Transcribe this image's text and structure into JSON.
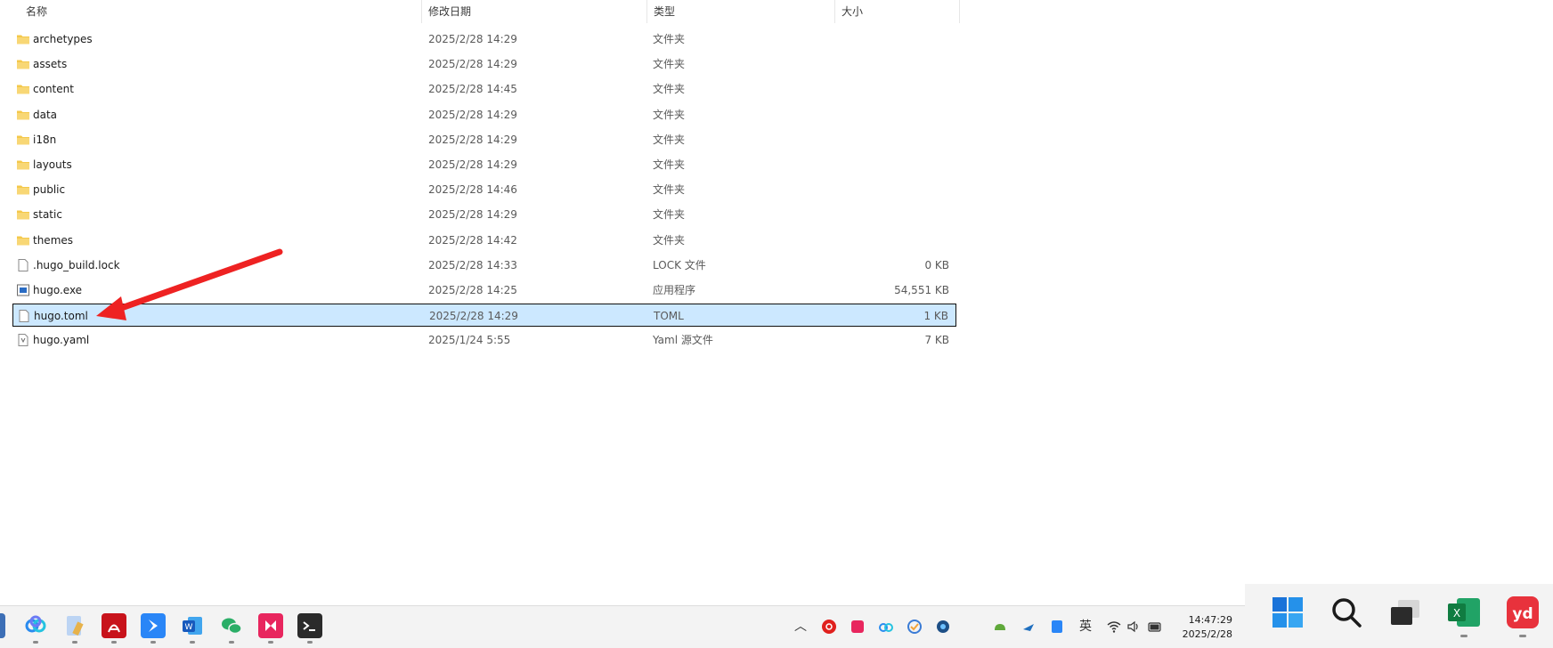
{
  "columns": {
    "name": "名称",
    "date": "修改日期",
    "type": "类型",
    "size": "大小"
  },
  "files": [
    {
      "name": "archetypes",
      "date": "2025/2/28 14:29",
      "type": "文件夹",
      "size": "",
      "icon": "folder-icon"
    },
    {
      "name": "assets",
      "date": "2025/2/28 14:29",
      "type": "文件夹",
      "size": "",
      "icon": "folder-icon"
    },
    {
      "name": "content",
      "date": "2025/2/28 14:45",
      "type": "文件夹",
      "size": "",
      "icon": "folder-icon"
    },
    {
      "name": "data",
      "date": "2025/2/28 14:29",
      "type": "文件夹",
      "size": "",
      "icon": "folder-icon"
    },
    {
      "name": "i18n",
      "date": "2025/2/28 14:29",
      "type": "文件夹",
      "size": "",
      "icon": "folder-icon"
    },
    {
      "name": "layouts",
      "date": "2025/2/28 14:29",
      "type": "文件夹",
      "size": "",
      "icon": "folder-icon"
    },
    {
      "name": "public",
      "date": "2025/2/28 14:46",
      "type": "文件夹",
      "size": "",
      "icon": "folder-icon"
    },
    {
      "name": "static",
      "date": "2025/2/28 14:29",
      "type": "文件夹",
      "size": "",
      "icon": "folder-icon"
    },
    {
      "name": "themes",
      "date": "2025/2/28 14:42",
      "type": "文件夹",
      "size": "",
      "icon": "folder-icon"
    },
    {
      "name": ".hugo_build.lock",
      "date": "2025/2/28 14:33",
      "type": "LOCK 文件",
      "size": "0 KB",
      "icon": "file-icon"
    },
    {
      "name": "hugo.exe",
      "date": "2025/2/28 14:25",
      "type": "应用程序",
      "size": "54,551 KB",
      "icon": "exe-icon"
    },
    {
      "name": "hugo.toml",
      "date": "2025/2/28 14:29",
      "type": "TOML",
      "size": "1 KB",
      "icon": "file-icon",
      "selected": true
    },
    {
      "name": "hugo.yaml",
      "date": "2025/1/24 5:55",
      "type": "Yaml 源文件",
      "size": "7 KB",
      "icon": "yaml-file-icon"
    }
  ],
  "taskbar": {
    "ime": "英",
    "time": "14:47:29",
    "date": "2025/2/28",
    "apps": [
      "baidu-netdisk-icon",
      "notepad-icon",
      "acrobat-icon",
      "feishu-icon",
      "word-icon",
      "wechat-icon",
      "app-icon",
      "terminal-icon"
    ],
    "tray": [
      "chevron-up-icon",
      "netease-music-icon",
      "app-icon",
      "baidu-netdisk-icon",
      "task-icon",
      "browser-icon",
      "android-icon",
      "network-app-icon",
      "bluetooth-app-icon",
      "wifi-icon",
      "volume-icon",
      "battery-icon"
    ],
    "pinned": [
      "windows-start-icon",
      "search-icon",
      "task-view-icon",
      "excel-icon",
      "youdao-icon"
    ]
  },
  "colors": {
    "selection": "#cce8ff",
    "arrow": "#ee2222",
    "folder": "#f4c84a",
    "taskbar": "#f3f3f3"
  }
}
